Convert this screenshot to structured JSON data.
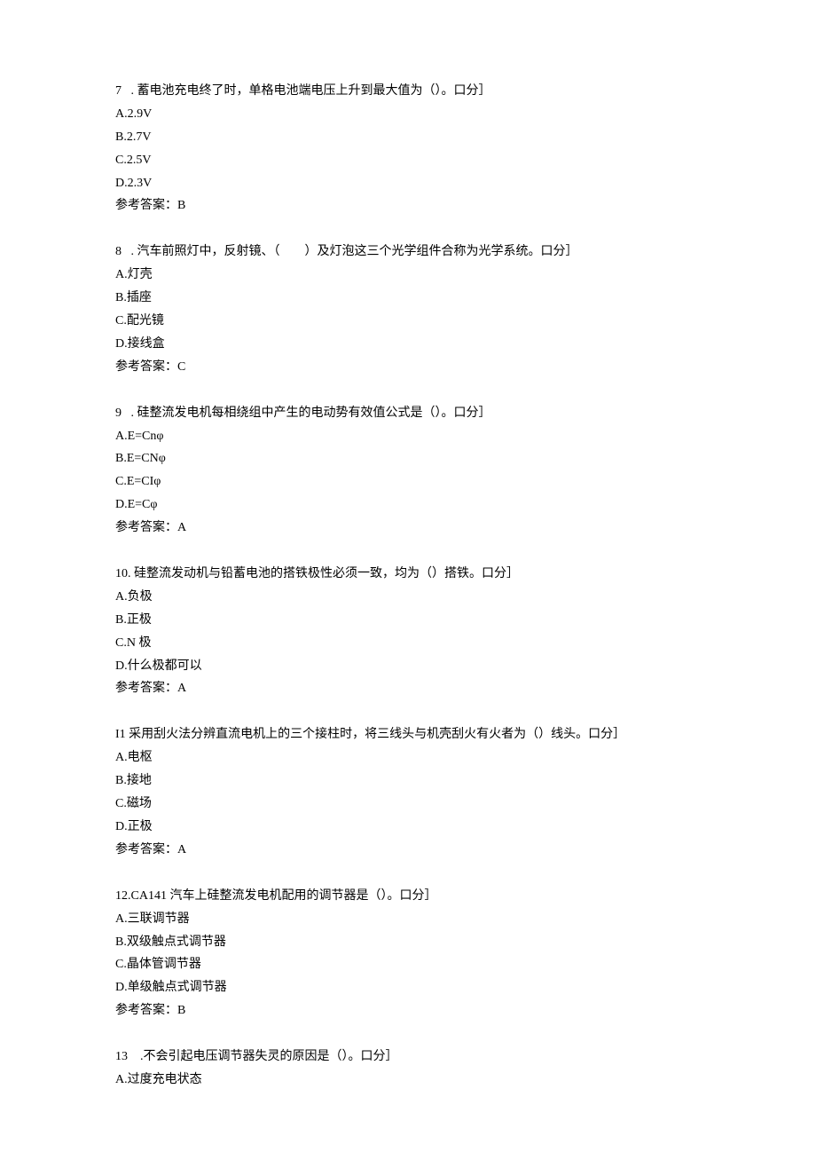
{
  "questions": [
    {
      "number": "7",
      "stem_prefix": "7   . ",
      "stem": "蓄电池充电终了时，单格电池端电压上升到最大值为（）。口分］",
      "options": [
        "A.2.9V",
        "B.2.7V",
        "C.2.5V",
        "D.2.3V"
      ],
      "answer": "参考答案：B"
    },
    {
      "number": "8",
      "stem_prefix": "8   . ",
      "stem": "汽车前照灯中，反射镜、（        ）及灯泡这三个光学组件合称为光学系统。口分］",
      "options": [
        "A.灯壳",
        "B.插座",
        "C.配光镜",
        "D.接线盒"
      ],
      "answer": "参考答案：C"
    },
    {
      "number": "9",
      "stem_prefix": "9   . ",
      "stem": "硅整流发电机每相绕组中产生的电动势有效值公式是（）。口分］",
      "options": [
        "A.E=Cnφ",
        "B.E=CNφ",
        "C.E=CIφ",
        "D.E=Cφ"
      ],
      "answer": "参考答案：A"
    },
    {
      "number": "10",
      "stem_prefix": "10. ",
      "stem": "硅整流发动机与铅蓄电池的搭铁极性必须一致，均为（）搭铁。口分］",
      "options": [
        "A.负极",
        "B.正极",
        "C.N 极",
        "D.什么极都可以"
      ],
      "answer": "参考答案：A"
    },
    {
      "number": "11",
      "stem_prefix": "I1 ",
      "stem": "采用刮火法分辨直流电机上的三个接柱时，将三线头与机壳刮火有火者为（）线头。口分］",
      "options": [
        "A.电枢",
        "B.接地",
        "C.磁场",
        "D.正极"
      ],
      "answer": "参考答案：A"
    },
    {
      "number": "12",
      "stem_prefix": "12.",
      "stem": "CA141 汽车上硅整流发电机配用的调节器是（）。口分］",
      "options": [
        "A.三联调节器",
        "B.双级触点式调节器",
        "C.晶体管调节器",
        "D.单级触点式调节器"
      ],
      "answer": "参考答案：B"
    },
    {
      "number": "13",
      "stem_prefix": "13    .",
      "stem": "不会引起电压调节器失灵的原因是（）。口分］",
      "options": [
        "A.过度充电状态"
      ],
      "answer": ""
    }
  ]
}
